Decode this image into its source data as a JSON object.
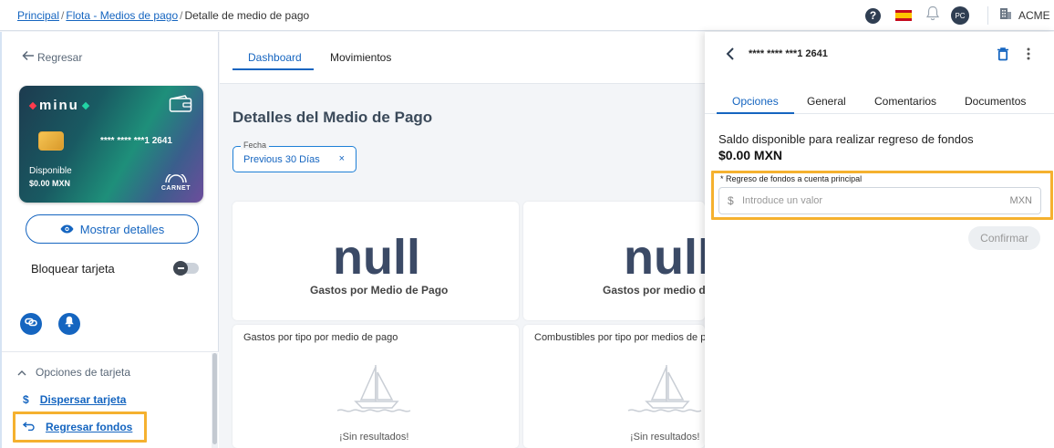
{
  "breadcrumb": {
    "home": "Principal",
    "fleet": "Flota - Medios de pago",
    "current": "Detalle de medio de pago"
  },
  "header": {
    "avatar_initials": "PC",
    "company": "ACME Inc",
    "help": "?"
  },
  "sidebar": {
    "back_label": "Regresar",
    "card": {
      "brand": "minu",
      "number": "**** **** ***1 2641",
      "available_label": "Disponible",
      "balance": "$0.00 MXN",
      "network": "CARNET"
    },
    "show_details_label": "Mostrar detalles",
    "block_card_label": "Bloquear tarjeta",
    "block_card_on": false,
    "options_header": "Opciones de tarjeta",
    "options": [
      {
        "label": "Dispersar tarjeta",
        "icon": "dollar-icon"
      },
      {
        "label": "Regresar fondos",
        "icon": "return-arrow-icon"
      }
    ]
  },
  "main": {
    "tabs": [
      {
        "label": "Dashboard",
        "active": true
      },
      {
        "label": "Movimientos",
        "active": false
      }
    ],
    "title": "Detalles del Medio de Pago",
    "date_filter": {
      "legend": "Fecha",
      "value": "Previous 30 Días",
      "clear": "×"
    },
    "stats": [
      {
        "value": "null",
        "label": "Gastos por Medio de Pago"
      },
      {
        "value": "null",
        "label": "Gastos por medio de pago"
      }
    ],
    "charts": [
      {
        "title": "Gastos por tipo por medio de pago",
        "empty": "¡Sin resultados!"
      },
      {
        "title": "Combustibles por tipo por medios de pago",
        "empty": "¡Sin resultados!"
      }
    ]
  },
  "drawer": {
    "title": "**** **** ***1 2641",
    "tabs": [
      {
        "label": "Opciones",
        "active": true
      },
      {
        "label": "General",
        "active": false
      },
      {
        "label": "Comentarios",
        "active": false
      },
      {
        "label": "Documentos",
        "active": false
      }
    ],
    "saldo_label": "Saldo disponible para realizar regreso de fondos",
    "saldo_value": "$0.00 MXN",
    "field_label": "* Regreso de fondos a cuenta principal",
    "field_currency": "$",
    "field_placeholder": "Introduce un valor",
    "field_value": "",
    "field_unit": "MXN",
    "confirm_label": "Confirmar"
  },
  "colors": {
    "primary": "#1565c0",
    "highlight": "#f5b12f",
    "dark": "#2f3e52"
  }
}
